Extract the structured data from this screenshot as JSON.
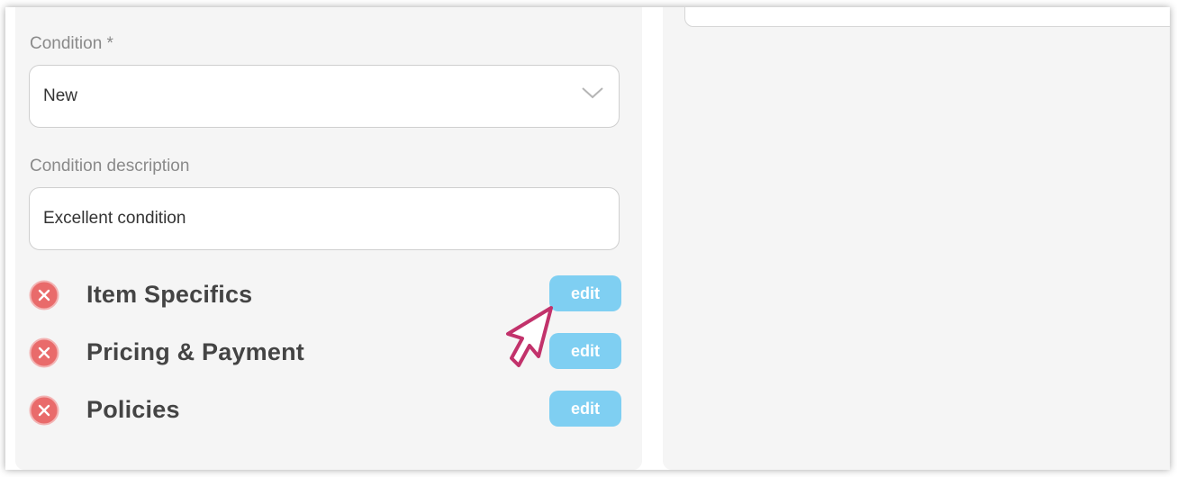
{
  "form": {
    "condition_label": "Condition *",
    "condition_value": "New",
    "condition_description_label": "Condition description",
    "condition_description_value": "Excellent condition"
  },
  "sections": [
    {
      "title": "Item Specifics",
      "edit_label": "edit",
      "status": "incomplete"
    },
    {
      "title": "Pricing & Payment",
      "edit_label": "edit",
      "status": "incomplete"
    },
    {
      "title": "Policies",
      "edit_label": "edit",
      "status": "incomplete"
    }
  ],
  "icons": {
    "dropdown": "chevron-down-icon",
    "status": "error-x-icon",
    "pointer": "pointer-cursor-icon"
  },
  "colors": {
    "edit_button": "#7fcff2",
    "error_icon": "#e96b6b",
    "cursor_outline": "#c2326b",
    "panel_background": "#f5f5f5"
  }
}
